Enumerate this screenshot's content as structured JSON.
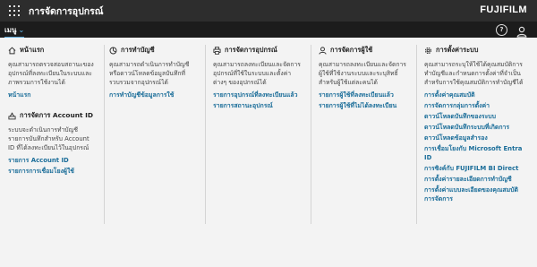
{
  "header": {
    "title": "การจัดการอุปกรณ์",
    "brand": "FUJIFILM"
  },
  "menu": {
    "label": "เมนู"
  },
  "home": {
    "title": "หน้าแรก",
    "description": "คุณสามารถตรวจสอบสถานะของอุปกรณ์ที่ลงทะเบียนในระบบและภาพรวมการใช้งานได้",
    "link": "หน้าแรก"
  },
  "account": {
    "title": "การจัดการ Account ID",
    "description": "ระบบจะดำเนินการทำบัญชีรายการบันทึกสำหรับ Account ID ที่ได้ลงทะเบียนไว้ในอุปกรณ์",
    "links": [
      "รายการ Account ID",
      "รายการการเชื่อมโยงผู้ใช้"
    ]
  },
  "billing": {
    "title": "การทำบัญชี",
    "description": "คุณสามารถดำเนินการทำบัญชีหรือดาวน์โหลดข้อมูลบันทึกที่รวบรวมจากอุปกรณ์ได้",
    "links": [
      "การทำบัญชีข้อมูลการใช้"
    ]
  },
  "devices": {
    "title": "การจัดการอุปกรณ์",
    "description": "คุณสามารถลงทะเบียนและจัดการอุปกรณ์ที่ใช้ในระบบและตั้งค่าต่างๆ ของอุปกรณ์ได้",
    "links": [
      "รายการอุปกรณ์ที่ลงทะเบียนแล้ว",
      "รายการสถานะอุปกรณ์"
    ]
  },
  "users": {
    "title": "การจัดการผู้ใช้",
    "description": "คุณสามารถลงทะเบียนและจัดการผู้ใช้ที่ใช้งานระบบและระบุสิทธิ์สำหรับผู้ใช้แต่ละคนได้",
    "links": [
      "รายการผู้ใช้ที่ลงทะเบียนแล้ว",
      "รายการผู้ใช้ที่ไม่ได้ลงทะเบียน"
    ]
  },
  "settings": {
    "title": "การตั้งค่าระบบ",
    "description": "คุณสามารถระบุให้ใช้ได้คุณสมบัติการทำบัญชีและกำหนดการตั้งค่าที่จำเป็นสำหรับการใช้คุณสมบัติการทำบัญชีได้",
    "links": [
      "การตั้งค่าคุณสมบัติ",
      "การจัดการกลุ่มการตั้งค่า",
      "ดาวน์โหลดบันทึกของระบบ",
      "ดาวน์โหลดบันทึกระบบที่เกิดการ",
      "ดาวน์โหลดข้อมูลสำรอง",
      "การเชื่อมโยงกับ Microsoft Entra ID",
      "การซิงค์กับ FUJIFILM BI Direct",
      "การตั้งค่ารายละเอียดการทำบัญชี",
      "การตั้งค่าแบบละเอียดของคุณสมบัติการจัดการ"
    ]
  }
}
